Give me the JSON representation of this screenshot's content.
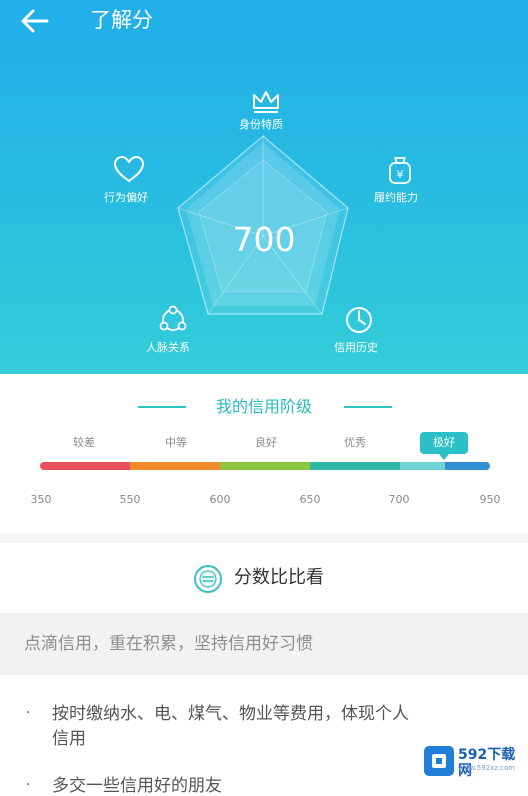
{
  "header": {
    "title": "了解分",
    "back_icon": "arrow-left-icon"
  },
  "radar": {
    "score": "700",
    "dimensions": [
      {
        "key": "identity",
        "label": "身份特质",
        "icon": "crown-icon"
      },
      {
        "key": "ability",
        "label": "履约能力",
        "icon": "money-bag-icon"
      },
      {
        "key": "history",
        "label": "信用历史",
        "icon": "clock-icon"
      },
      {
        "key": "connections",
        "label": "人脉关系",
        "icon": "people-network-icon"
      },
      {
        "key": "behavior",
        "label": "行为偏好",
        "icon": "heart-icon"
      }
    ],
    "colors": {
      "background_top": "#21aee9",
      "background_bottom": "#34cdd8",
      "polygon_fill": "rgba(255,255,255,0.18)"
    }
  },
  "credit_level": {
    "title": "我的信用阶级",
    "levels": [
      "较差",
      "中等",
      "良好",
      "优秀",
      "极好"
    ],
    "current_level": "极好",
    "ticks": [
      "350",
      "550",
      "600",
      "650",
      "700",
      "950"
    ],
    "bar_colors": [
      "#e8505b",
      "#f08a2a",
      "#8cc63f",
      "#2fb7a3",
      "#6fd3d6",
      "#2e8fd3"
    ]
  },
  "compare": {
    "label": "分数比比看",
    "icon": "compare-icon"
  },
  "tip": {
    "text": "点滴信用，重在积累，坚持信用好习惯"
  },
  "advice": {
    "items": [
      {
        "bullet": "·",
        "lines": [
          "按时缴纳水、电、煤气、物业等费用，体现个人",
          "信用"
        ]
      },
      {
        "bullet": "·",
        "lines": [
          "多交一些信用好的朋友"
        ]
      }
    ]
  },
  "watermark": {
    "text": "592下载网",
    "sub": "www.592xz.com"
  }
}
